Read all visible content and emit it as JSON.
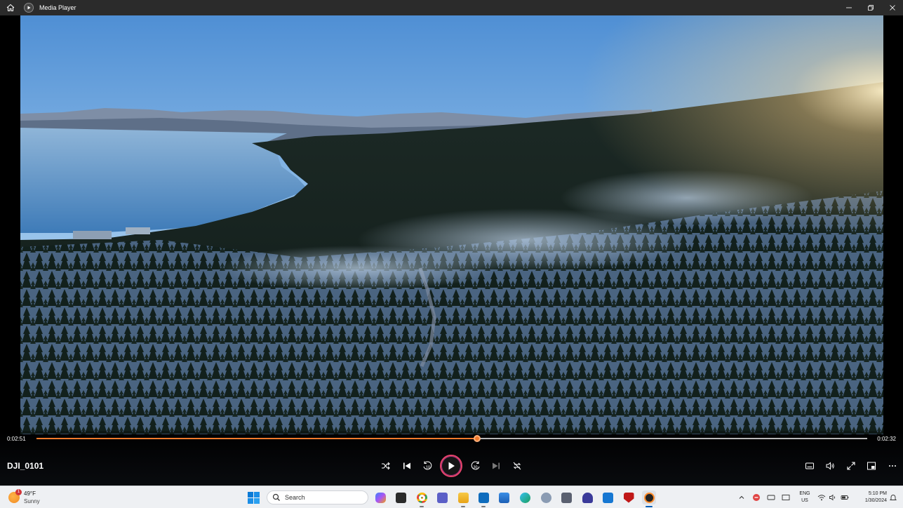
{
  "window": {
    "title": "Media Player",
    "icons": [
      "home-icon",
      "media-player-icon",
      "minimize-icon",
      "restore-icon",
      "close-icon"
    ]
  },
  "player": {
    "media_title": "DJI_0101",
    "elapsed": "0:02:51",
    "remaining": "0:02:32",
    "progress_fraction": 0.53,
    "accent_color": "#f07a2c",
    "controls": [
      "shuffle-icon",
      "previous-icon",
      "skip-back-10-icon",
      "play-icon",
      "skip-forward-30-icon",
      "next-icon",
      "repeat-off-icon",
      "subtitles-icon",
      "volume-icon",
      "fullscreen-icon",
      "mini-player-icon",
      "more-options-icon"
    ],
    "skip_back_label": "10",
    "skip_forward_label": "30"
  },
  "taskbar": {
    "weather": {
      "temp": "49°F",
      "condition": "Sunny",
      "badge": "1"
    },
    "search_placeholder": "Search",
    "apps": [
      "copilot-icon",
      "file-manager-icon",
      "chrome-icon",
      "teams-icon",
      "file-explorer-icon",
      "mail-icon",
      "store-icon",
      "edge-icon",
      "r-icon",
      "calculator-icon",
      "headphones-icon",
      "blue-app-icon",
      "mcafee-icon",
      "media-player-icon"
    ],
    "tray_icons": [
      "chevron-up-icon",
      "security-icon",
      "keyboard-icon",
      "display-icon",
      "wifi-icon",
      "speaker-icon",
      "battery-icon",
      "notifications-icon"
    ],
    "language": {
      "line1": "ENG",
      "line2": "US"
    },
    "clock": {
      "time": "5:10 PM",
      "date": "1/30/2024"
    }
  }
}
